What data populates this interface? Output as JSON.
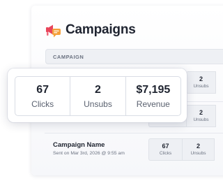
{
  "header": {
    "title": "Campaigns"
  },
  "table": {
    "column_header": "CAMPAIGN"
  },
  "rows": [
    {
      "stats": [
        {
          "value": "2",
          "label": "Unsubs"
        }
      ]
    },
    {
      "stats": [
        {
          "value": "2",
          "label": "Unsubs"
        }
      ]
    },
    {
      "name": "Campaign Name",
      "sent": "Sent on Mar 3rd, 2026 @ 9:55 am",
      "stats": [
        {
          "value": "67",
          "label": "Clicks"
        },
        {
          "value": "2",
          "label": "Unsubs"
        }
      ]
    }
  ],
  "popup": {
    "stats": [
      {
        "value": "67",
        "label": "Clicks"
      },
      {
        "value": "2",
        "label": "Unsubs"
      },
      {
        "value": "$7,195",
        "label": "Revenue"
      }
    ]
  },
  "colors": {
    "icon_red": "#e8455a",
    "icon_orange": "#f4a03a",
    "icon_blue": "#3f7fe0"
  }
}
